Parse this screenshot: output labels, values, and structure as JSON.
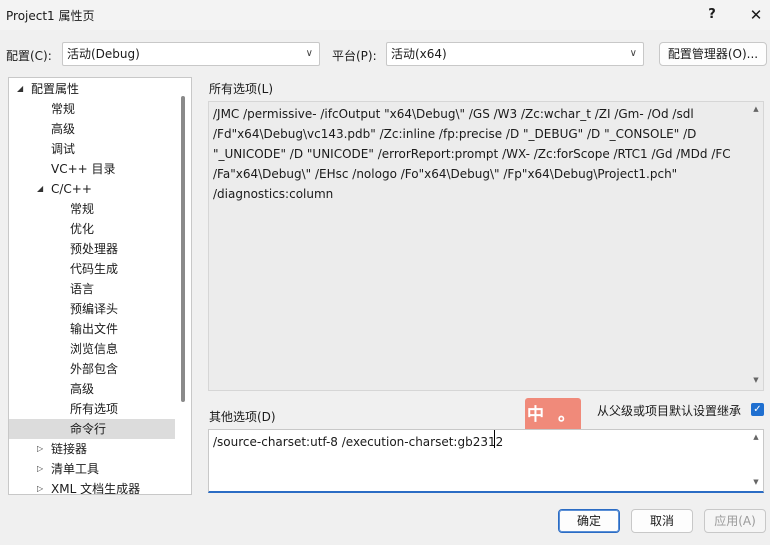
{
  "window": {
    "title": "Project1 属性页",
    "help": "?",
    "close": "✕"
  },
  "config": {
    "label": "配置(C):",
    "value": "活动(Debug)",
    "platform_label": "平台(P):",
    "platform_value": "活动(x64)",
    "manager_button": "配置管理器(O)..."
  },
  "tree": {
    "items": [
      {
        "label": "配置属性",
        "level": 0,
        "arrow": "expanded"
      },
      {
        "label": "常规",
        "level": 1
      },
      {
        "label": "高级",
        "level": 1
      },
      {
        "label": "调试",
        "level": 1
      },
      {
        "label": "VC++ 目录",
        "level": 1
      },
      {
        "label": "C/C++",
        "level": 1,
        "arrow": "expanded"
      },
      {
        "label": "常规",
        "level": 2
      },
      {
        "label": "优化",
        "level": 2
      },
      {
        "label": "预处理器",
        "level": 2
      },
      {
        "label": "代码生成",
        "level": 2
      },
      {
        "label": "语言",
        "level": 2
      },
      {
        "label": "预编译头",
        "level": 2
      },
      {
        "label": "输出文件",
        "level": 2
      },
      {
        "label": "浏览信息",
        "level": 2
      },
      {
        "label": "外部包含",
        "level": 2
      },
      {
        "label": "高级",
        "level": 2
      },
      {
        "label": "所有选项",
        "level": 2
      },
      {
        "label": "命令行",
        "level": 2,
        "selected": true
      },
      {
        "label": "链接器",
        "level": 1,
        "arrow": "collapsed"
      },
      {
        "label": "清单工具",
        "level": 1,
        "arrow": "collapsed"
      },
      {
        "label": "XML 文档生成器",
        "level": 1,
        "arrow": "collapsed"
      }
    ]
  },
  "all_options": {
    "label": "所有选项(L)",
    "lines": [
      "/JMC /permissive- /ifcOutput \"x64\\Debug\\\" /GS /W3 /Zc:wchar_t /ZI /Gm- /Od /sdl",
      "/Fd\"x64\\Debug\\vc143.pdb\" /Zc:inline /fp:precise /D \"_DEBUG\" /D \"_CONSOLE\" /D",
      "\"_UNICODE\" /D \"UNICODE\" /errorReport:prompt /WX- /Zc:forScope /RTC1 /Gd /MDd /FC",
      "/Fa\"x64\\Debug\\\" /EHsc /nologo /Fo\"x64\\Debug\\\" /Fp\"x64\\Debug\\Project1.pch\"",
      "/diagnostics:column"
    ]
  },
  "other_options": {
    "label": "其他选项(D)",
    "value": "/source-charset:utf-8 /execution-charset:gb2312",
    "inherit_label": "从父级或项目默认设置继承",
    "inherit_checked": true
  },
  "ime": {
    "text": "中 。"
  },
  "buttons": {
    "ok": "确定",
    "cancel": "取消",
    "apply": "应用(A)"
  },
  "colors": {
    "accent": "#1f6fd0",
    "ime_badge": "#f08a7a",
    "selected_row": "#dcdcdc"
  }
}
